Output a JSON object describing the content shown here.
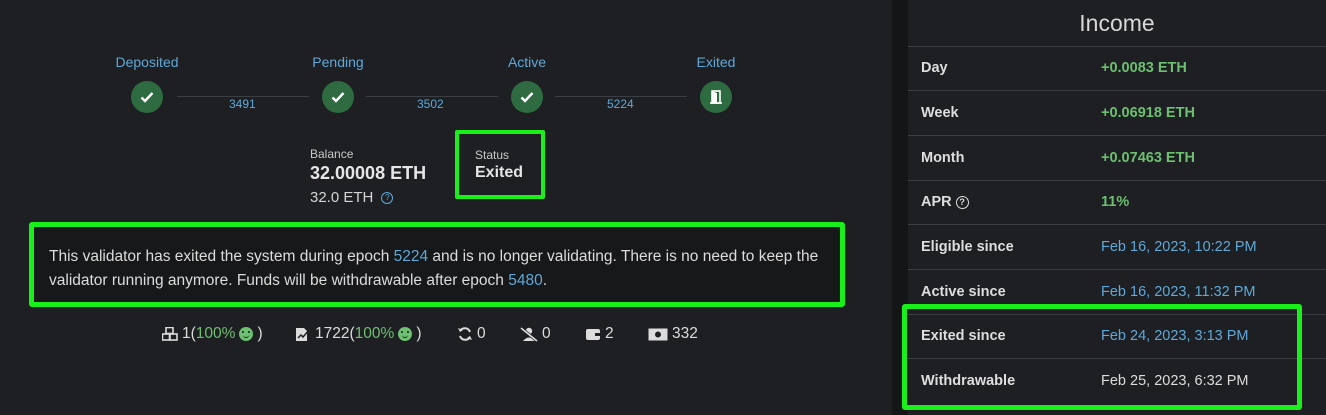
{
  "stepper": {
    "steps": [
      {
        "label": "Deposited",
        "icon": "check-icon"
      },
      {
        "label": "Pending",
        "icon": "check-icon"
      },
      {
        "label": "Active",
        "icon": "check-icon"
      },
      {
        "label": "Exited",
        "icon": "door-exit-icon"
      }
    ],
    "epochs": [
      "3491",
      "3502",
      "5224"
    ]
  },
  "balance": {
    "label": "Balance",
    "value": "32.00008 ETH",
    "effective": "32.0 ETH"
  },
  "status": {
    "label": "Status",
    "value": "Exited"
  },
  "message": {
    "part1": "This validator has exited the system during epoch ",
    "epoch_exit": "5224",
    "part2": " and is no longer validating. There is no need to keep the validator running anymore. Funds will be withdrawable after epoch ",
    "epoch_withdraw": "5480",
    "part3": "."
  },
  "stats": {
    "attestations_count": "1(",
    "attestations_pct": "100%",
    "attestations_close": ")",
    "proposals_count": "1722(",
    "proposals_pct": "100%",
    "proposals_close": ")",
    "sync": "0",
    "slashings": "0",
    "deposits": "2",
    "withdrawals": "332"
  },
  "income": {
    "title": "Income",
    "rows": [
      {
        "key": "Day",
        "value": "+0.0083 ETH",
        "style": "green"
      },
      {
        "key": "Week",
        "value": "+0.06918 ETH",
        "style": "green"
      },
      {
        "key": "Month",
        "value": "+0.07463 ETH",
        "style": "green"
      },
      {
        "key": "APR",
        "value": "11%",
        "style": "green"
      },
      {
        "key": "Eligible since",
        "value": "Feb 16, 2023, 10:22 PM",
        "style": "blue"
      },
      {
        "key": "Active since",
        "value": "Feb 16, 2023, 11:32 PM",
        "style": "blue"
      },
      {
        "key": "Exited since",
        "value": "Feb 24, 2023, 3:13 PM",
        "style": "blue"
      },
      {
        "key": "Withdrawable",
        "value": "Feb 25, 2023, 6:32 PM",
        "style": "plain"
      }
    ]
  },
  "colors": {
    "accent": "#5fa8d8",
    "success": "#6cc070",
    "highlight": "#19f019",
    "step_bg": "#2e6b40"
  }
}
